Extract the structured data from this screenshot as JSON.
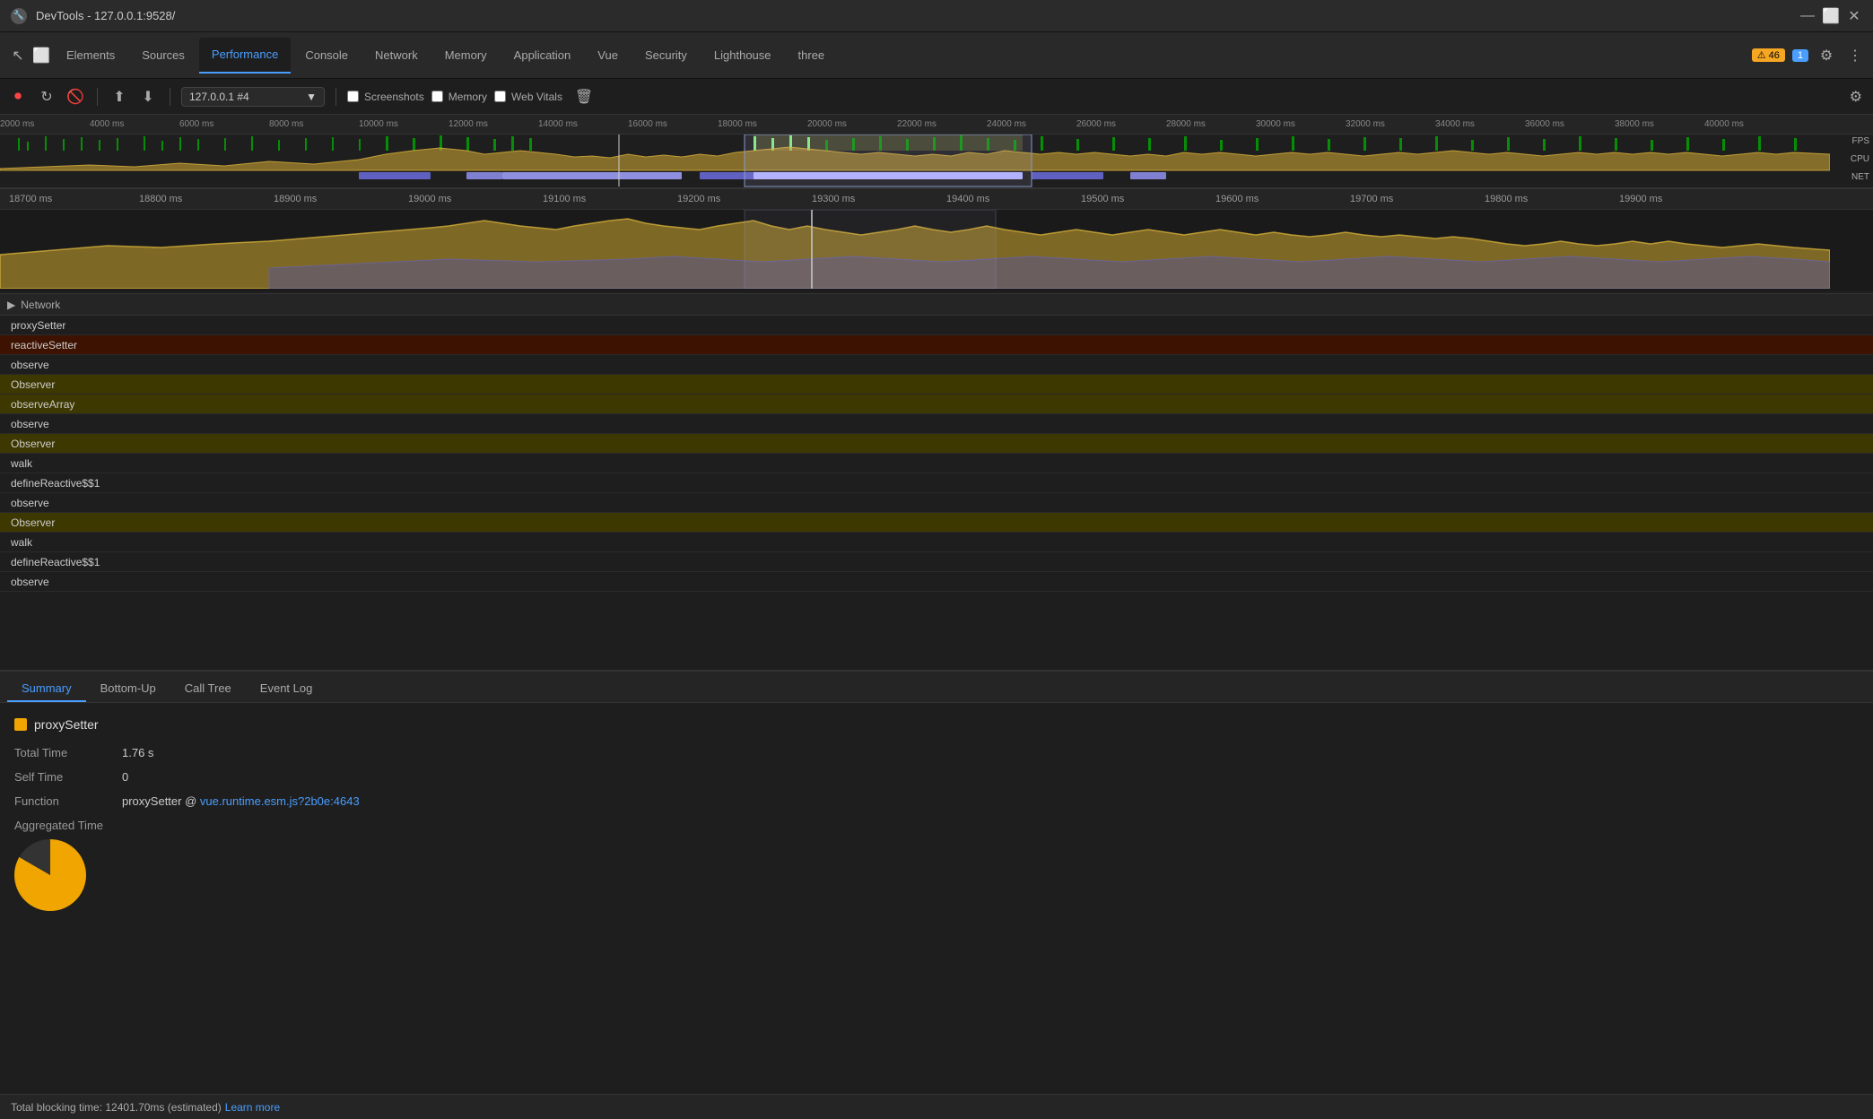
{
  "titleBar": {
    "icon": "🔧",
    "title": "DevTools - 127.0.0.1:9528/",
    "minimize": "—",
    "maximize": "⬜",
    "close": "✕"
  },
  "tabs": [
    {
      "label": "Elements",
      "active": false
    },
    {
      "label": "Sources",
      "active": false
    },
    {
      "label": "Performance",
      "active": true
    },
    {
      "label": "Console",
      "active": false
    },
    {
      "label": "Network",
      "active": false
    },
    {
      "label": "Memory",
      "active": false
    },
    {
      "label": "Application",
      "active": false
    },
    {
      "label": "Vue",
      "active": false
    },
    {
      "label": "Security",
      "active": false
    },
    {
      "label": "Lighthouse",
      "active": false
    },
    {
      "label": "three",
      "active": false
    }
  ],
  "toolbar": {
    "urlSelector": "127.0.0.1 #4",
    "screenshots_label": "Screenshots",
    "memory_label": "Memory",
    "web_vitals_label": "Web Vitals"
  },
  "alertBadge": {
    "icon": "⚠",
    "count": "46"
  },
  "infoBadge": {
    "count": "1"
  },
  "timeRuler": {
    "labels": [
      "2000 ms",
      "4000 ms",
      "6000 ms",
      "8000 ms",
      "10000 ms",
      "12000 ms",
      "14000 ms",
      "16000 ms",
      "18000 ms",
      "20000 ms",
      "22000 ms",
      "24000 ms",
      "26000 ms",
      "28000 ms",
      "30000 ms",
      "32000 ms",
      "34000 ms",
      "36000 ms",
      "38000 ms",
      "40000 ms"
    ]
  },
  "sideLabels": {
    "fps": "FPS",
    "cpu": "CPU",
    "net": "NET"
  },
  "zoomRuler": {
    "labels": [
      "18700 ms",
      "18800 ms",
      "18900 ms",
      "19000 ms",
      "19100 ms",
      "19200 ms",
      "19300 ms",
      "19400 ms",
      "19500 ms",
      "19600 ms",
      "19700 ms",
      "19800 ms",
      "19900 ms"
    ]
  },
  "network": {
    "label": "Network"
  },
  "callStack": [
    {
      "label": "proxySetter",
      "highlight": "none"
    },
    {
      "label": "reactiveSetter",
      "highlight": "red"
    },
    {
      "label": "observe",
      "highlight": "none"
    },
    {
      "label": "Observer",
      "highlight": "yellow"
    },
    {
      "label": "observeArray",
      "highlight": "yellow"
    },
    {
      "label": "observe",
      "highlight": "none"
    },
    {
      "label": "Observer",
      "highlight": "yellow"
    },
    {
      "label": "walk",
      "highlight": "none"
    },
    {
      "label": "defineReactive$$1",
      "highlight": "none"
    },
    {
      "label": "observe",
      "highlight": "none"
    },
    {
      "label": "Observer",
      "highlight": "yellow"
    },
    {
      "label": "walk",
      "highlight": "none"
    },
    {
      "label": "defineReactive$$1",
      "highlight": "none"
    },
    {
      "label": "observe",
      "highlight": "none"
    }
  ],
  "bottomTabs": [
    {
      "label": "Summary",
      "active": true
    },
    {
      "label": "Bottom-Up",
      "active": false
    },
    {
      "label": "Call Tree",
      "active": false
    },
    {
      "label": "Event Log",
      "active": false
    }
  ],
  "summary": {
    "colorBox": "#f0a500",
    "title": "proxySetter",
    "totalTimeLabel": "Total Time",
    "totalTimeValue": "1.76 s",
    "selfTimeLabel": "Self Time",
    "selfTimeValue": "0",
    "functionLabel": "Function",
    "functionText": "proxySetter @ ",
    "functionLink": "vue.runtime.esm.js?2b0e:4643",
    "aggregatedTitle": "Aggregated Time"
  },
  "statusBar": {
    "text": "Total blocking time: 12401.70ms (estimated)",
    "linkText": "Learn more"
  }
}
